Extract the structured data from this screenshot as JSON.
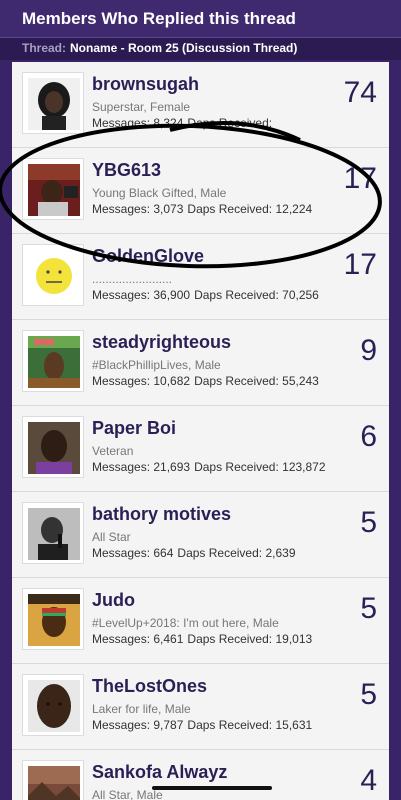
{
  "header": {
    "title": "Members Who Replied this thread"
  },
  "thread": {
    "label": "Thread:",
    "name": "Noname - Room 25 (Discussion Thread)"
  },
  "stats_labels": {
    "messages": "Messages:",
    "daps": "Daps Received:"
  },
  "members": [
    {
      "username": "brownsugah",
      "title": "Superstar, Female",
      "messages": "8,324",
      "daps": "",
      "count": "74",
      "avatar_icon": "woman-portrait"
    },
    {
      "username": "YBG613",
      "title": "Young Black Gifted, Male",
      "messages": "3,073",
      "daps": "12,224",
      "count": "17",
      "avatar_icon": "man-in-car"
    },
    {
      "username": "GoldenGlove",
      "title": "........................",
      "messages": "36,900",
      "daps": "70,256",
      "count": "17",
      "avatar_icon": "yellow-smiley-face"
    },
    {
      "username": "steadyrighteous",
      "title": "#BlackPhillipLives, Male",
      "messages": "10,682",
      "daps": "55,243",
      "count": "9",
      "avatar_icon": "movie-poster"
    },
    {
      "username": "Paper Boi",
      "title": "Veteran",
      "messages": "21,693",
      "daps": "123,872",
      "count": "6",
      "avatar_icon": "man-portrait"
    },
    {
      "username": "bathory motives",
      "title": "All Star",
      "messages": "664",
      "daps": "2,639",
      "count": "5",
      "avatar_icon": "bw-singer-portrait"
    },
    {
      "username": "Judo",
      "title": "#LevelUp+2018: I'm out here, Male",
      "messages": "6,461",
      "daps": "19,013",
      "count": "5",
      "avatar_icon": "rasta-man"
    },
    {
      "username": "TheLostOnes",
      "title": "Laker for life, Male",
      "messages": "9,787",
      "daps": "15,631",
      "count": "5",
      "avatar_icon": "man-face-closeup"
    },
    {
      "username": "Sankofa Alwayz",
      "title": "All Star, Male",
      "messages": "",
      "daps": "",
      "count": "4",
      "avatar_icon": "landscape-painting"
    }
  ],
  "colors": {
    "header_bg": "#3f2a70",
    "page_bg": "#3a2468",
    "name_color": "#2c1f55",
    "list_bg": "#f4f4f4"
  }
}
